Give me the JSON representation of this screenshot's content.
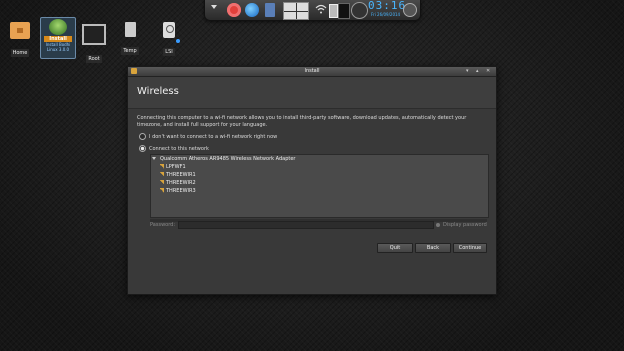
{
  "dock": {
    "time": "03:16",
    "time_suffix": "PM",
    "date": "Fri 26/09/2014"
  },
  "desktop": {
    "icons": [
      {
        "label": "Home"
      },
      {
        "label_line1": "Install",
        "label_line2": "Install Bodhi Linux 3.0.0"
      },
      {
        "label": "Root"
      },
      {
        "label": "Temp"
      },
      {
        "label": "LSI"
      }
    ]
  },
  "window": {
    "title": "Install",
    "heading": "Wireless",
    "description": "Connecting this computer to a wi-fi network allows you to install third-party software, download updates, automatically detect your timezone, and install full support for your language.",
    "option_no_connect": "I don't want to connect to a wi-fi network right now",
    "option_connect": "Connect to this network",
    "adapter": "Qualcomm Atheros AR9485 Wireless Network Adapter",
    "networks": [
      "LPFWF1",
      "THREEWIR1",
      "THREEWIR2",
      "THREEWIR3"
    ],
    "password_label": "Password:",
    "show_password": "Display password",
    "buttons": {
      "quit": "Quit",
      "back": "Back",
      "continue": "Continue"
    }
  },
  "colors": {
    "clock": "#49b6ff",
    "accent_orange": "#d78a1a"
  }
}
